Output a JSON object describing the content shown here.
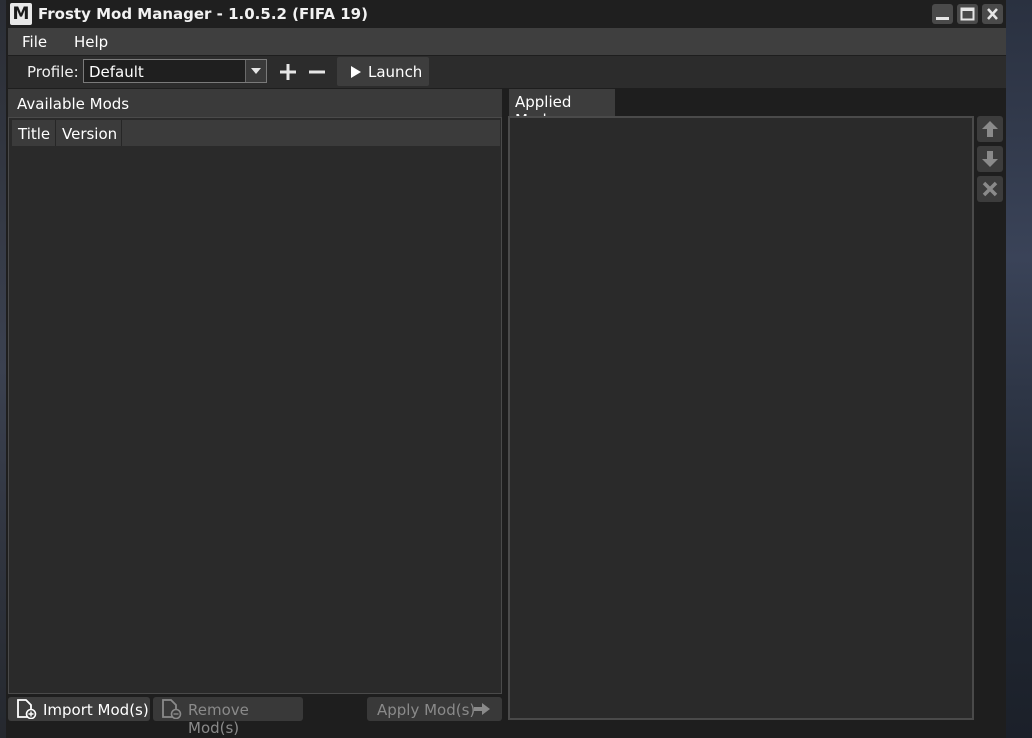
{
  "window": {
    "logo_letter": "M",
    "title": "Frosty Mod Manager - 1.0.5.2 (FIFA 19)"
  },
  "menu": {
    "items": [
      {
        "label": "File"
      },
      {
        "label": "Help"
      }
    ]
  },
  "toolbar": {
    "profile_label": "Profile:",
    "profile_value": "Default",
    "launch_label": "Launch"
  },
  "available_mods": {
    "header": "Available Mods",
    "columns": [
      "Title",
      "Version"
    ]
  },
  "applied_mods": {
    "tab_label": "Applied Mods"
  },
  "bottom": {
    "import_label": "Import Mod(s)",
    "remove_label": "Remove Mod(s)",
    "apply_label": "Apply Mod(s)"
  },
  "colors": {
    "background": "#1e1e1e",
    "menubar": "#3f3f3f",
    "panel": "#2a2a2a",
    "button": "#3d3d3d",
    "disabled_text": "#8a8a8a"
  }
}
